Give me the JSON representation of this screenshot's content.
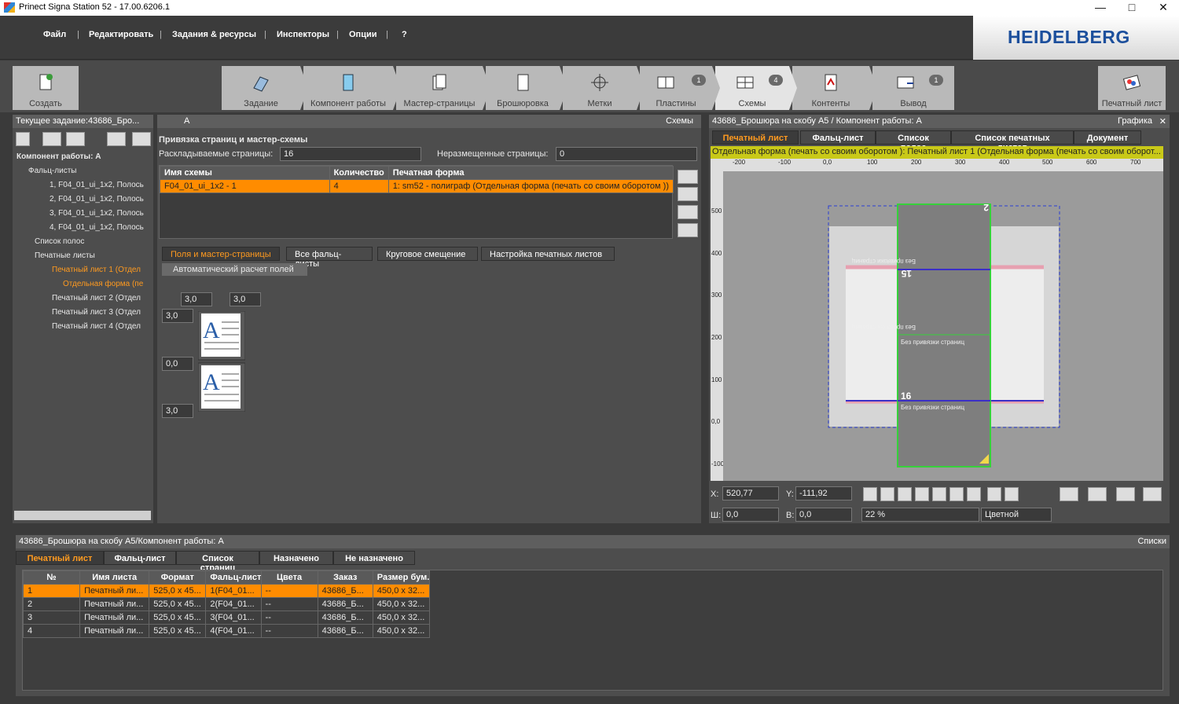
{
  "window": {
    "title": "Prinect Signa Station 52   -  17.00.6206.1"
  },
  "menu": [
    "Файл",
    "Редактировать",
    "Задания & ресурсы",
    "Инспекторы",
    "Опции",
    "?"
  ],
  "logo": "HEIDELBERG",
  "toolbar": {
    "create": "Создать",
    "steps": [
      {
        "label": "Задание",
        "badge": ""
      },
      {
        "label": "Компонент работы",
        "badge": ""
      },
      {
        "label": "Мастер-страницы",
        "badge": ""
      },
      {
        "label": "Брошюровка",
        "badge": ""
      },
      {
        "label": "Метки",
        "badge": ""
      },
      {
        "label": "Пластины",
        "badge": "1"
      },
      {
        "label": "Схемы",
        "badge": "4"
      },
      {
        "label": "Контенты",
        "badge": ""
      },
      {
        "label": "Вывод",
        "badge": "1"
      }
    ],
    "sheet": "Печатный лист"
  },
  "left": {
    "title": "Текущее задание:43686_Бро...",
    "tree": [
      "Компонент работы: A",
      "Фальц-листы",
      "1, F04_01_ui_1x2, Полось",
      "2, F04_01_ui_1x2, Полось",
      "3, F04_01_ui_1x2, Полось",
      "4, F04_01_ui_1x2, Полось",
      "Список полос",
      "Печатные листы",
      "Печатный лист 1 (Отдел",
      "Отдельная форма (пе",
      "Печатный лист 2 (Отдел",
      "Печатный лист 3 (Отдел",
      "Печатный лист 4 (Отдел"
    ]
  },
  "center": {
    "header_a": "A",
    "header_right": "Схемы",
    "section": "Привязка страниц и мастер-схемы",
    "pages_label": "Раскладываемые страницы:",
    "pages_value": "16",
    "unplaced_label": "Неразмещенные страницы:",
    "unplaced_value": "0",
    "cols": [
      "Имя схемы",
      "Количество",
      "Печатная форма"
    ],
    "row": {
      "name": "F04_01_ui_1x2 - 1",
      "count": "4",
      "form": "1: sm52 - полиграф (Отдельная форма (печать со своим оборотом ))"
    },
    "tabs": [
      "Поля и мастер-страницы",
      "Все фальц-листы",
      "Круговое смещение",
      "Настройка печатных листов"
    ],
    "auto_btn": "Автоматический расчет полей",
    "margins": [
      "3,0",
      "3,0",
      "3,0",
      "0,0",
      "3,0"
    ]
  },
  "right": {
    "title": "43686_Брошюра на скобу A5 / Компонент работы: A",
    "header_right": "Графика",
    "tabs": [
      "Печатный лист",
      "Фальц-лист",
      "Список полос",
      "Список печатных листов",
      "Документ"
    ],
    "info": "Отдельная форма (печать со своим оборотом ):  Печатный лист 1 (Отдельная форма (печать со своим оборот...",
    "ruler_x": [
      "-200",
      "-100",
      "0,0",
      "100",
      "200",
      "300",
      "400",
      "500",
      "600",
      "700"
    ],
    "ruler_y": [
      "500",
      "400",
      "300",
      "200",
      "100",
      "0,0",
      "-100"
    ],
    "labels": [
      "Без привязки страниц",
      "Без привязки страниц",
      "Без привязки страниц",
      "Без привязки страниц"
    ],
    "page_nums": [
      "2",
      "15",
      "16"
    ],
    "x_label": "X:",
    "x_val": "520,77",
    "y_label": "Y:",
    "y_val": "-111,92",
    "w_label": "Ш:",
    "w_val": "0,0",
    "h_label": "В:",
    "h_val": "0,0",
    "zoom": "22 %",
    "color": "Цветной"
  },
  "bottom": {
    "title": "43686_Брошюра на скобу A5/Компонент работы: A",
    "header_right": "Списки",
    "tabs": [
      "Печатный лист",
      "Фальц-лист",
      "Список страниц",
      "Назначено",
      "Не назначено"
    ],
    "cols": [
      "№",
      "Имя листа",
      "Формат",
      "Фальц-лист",
      "Цвета",
      "Заказ",
      "Размер бум..."
    ],
    "rows": [
      [
        "1",
        "Печатный ли...",
        "525,0 x 45...",
        "1(F04_01...",
        "--",
        "43686_Б...",
        "450,0 x 32..."
      ],
      [
        "2",
        "Печатный ли...",
        "525,0 x 45...",
        "2(F04_01...",
        "--",
        "43686_Б...",
        "450,0 x 32..."
      ],
      [
        "3",
        "Печатный ли...",
        "525,0 x 45...",
        "3(F04_01...",
        "--",
        "43686_Б...",
        "450,0 x 32..."
      ],
      [
        "4",
        "Печатный ли...",
        "525,0 x 45...",
        "4(F04_01...",
        "--",
        "43686_Б...",
        "450,0 x 32..."
      ]
    ]
  },
  "colors": {
    "accent": "#ff8c00",
    "brand": "#1c4f9c",
    "info_bar": "#c9c918"
  }
}
